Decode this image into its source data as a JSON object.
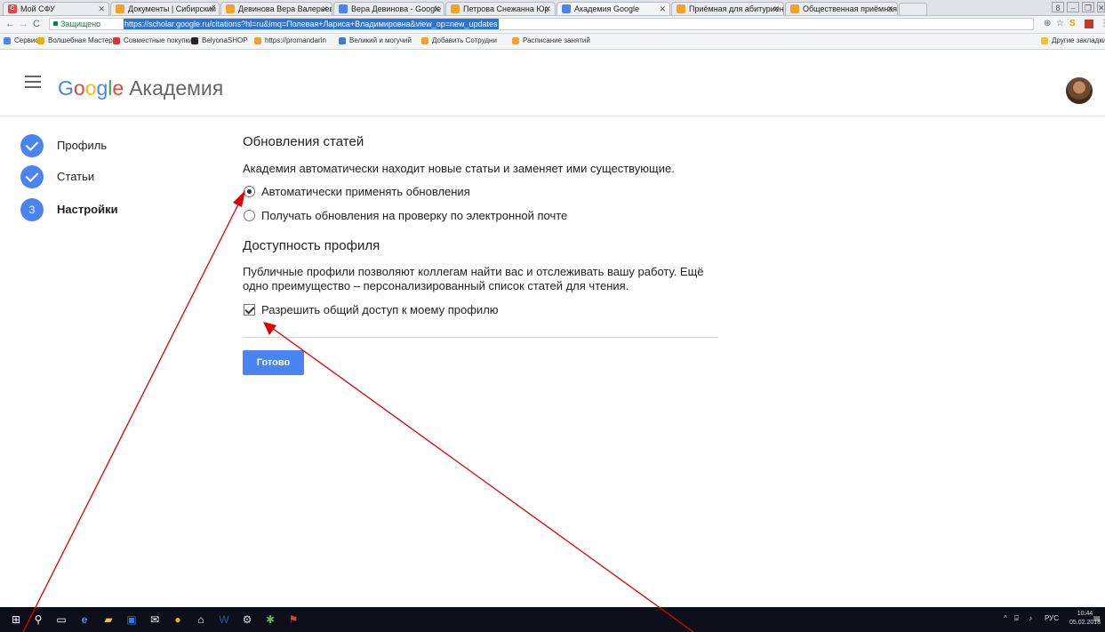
{
  "browser": {
    "tabs": [
      {
        "label": "Мой СФУ",
        "favicon": "sfu"
      },
      {
        "label": "Документы | Сибирский",
        "favicon": "orange"
      },
      {
        "label": "Девинова Вера Валерьевна",
        "favicon": "orange"
      },
      {
        "label": "Вера Девинова - Google",
        "favicon": "google"
      },
      {
        "label": "Петрова Снежанна Юр",
        "favicon": "orange"
      },
      {
        "label": "Академия Google",
        "favicon": "google"
      },
      {
        "label": "Приёмная для абитуриента",
        "favicon": "orange"
      },
      {
        "label": "Общественная приёмная",
        "favicon": "orange"
      }
    ],
    "secure_label": "Защищено",
    "url": "https://scholar.google.ru/citations?hl=ru&imq=Полевая+Лариса+Владимировна&view_op=new_updates",
    "bookmarks": [
      "Сервисы",
      "Волшебная Мастерс",
      "Совместные покупки",
      "BelyonaSHOP",
      "https://promandarin",
      "Великий и могучий",
      "Добавить Сотрудни",
      "Расписание занятий"
    ],
    "other_bookmarks": "Другие закладки"
  },
  "header": {
    "logo_google": "Google",
    "logo_academia": "Академия"
  },
  "steps": [
    {
      "label": "Профиль",
      "state": "done"
    },
    {
      "label": "Статьи",
      "state": "done"
    },
    {
      "label": "Настройки",
      "state": "current",
      "number": "3"
    }
  ],
  "updates": {
    "title": "Обновления статей",
    "description": "Академия автоматически находит новые статьи и заменяет ими существующие.",
    "option_auto": "Автоматически применять обновления",
    "option_email": "Получать обновления на проверку по электронной почте",
    "selected": "auto"
  },
  "visibility": {
    "title": "Доступность профиля",
    "description_line1": "Публичные профили позволяют коллегам найти вас и отслеживать вашу работу. Ещё",
    "description_line2": "одно преимущество – персонализированный список статей для чтения.",
    "checkbox_label": "Разрешить общий доступ к моему профилю",
    "checked": true
  },
  "done_button": "Готово",
  "taskbar": {
    "language": "РУС",
    "time": "10:44",
    "date": "05.02.2018"
  },
  "colors": {
    "accent": "#4a84f2",
    "annotation_arrow": "#e00000",
    "taskbar": "#0c0e1a"
  }
}
